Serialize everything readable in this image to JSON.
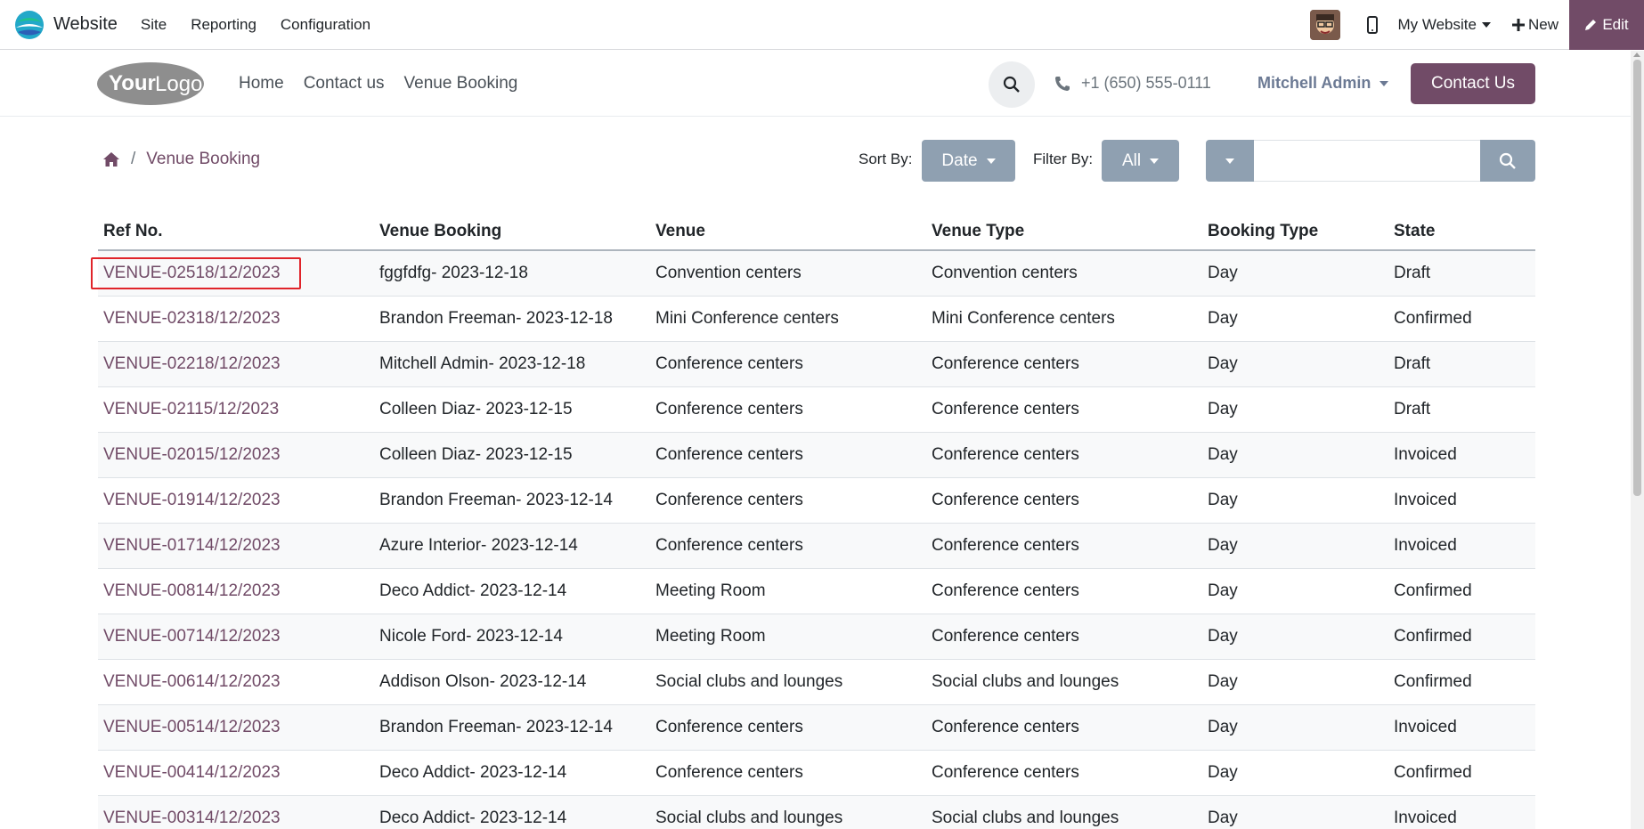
{
  "topbar": {
    "app_name": "Website",
    "menu": [
      "Site",
      "Reporting",
      "Configuration"
    ],
    "website_selector": "My Website",
    "new_label": "New",
    "edit_label": "Edit"
  },
  "header": {
    "logo_text": "YourLogo",
    "nav": [
      "Home",
      "Contact us",
      "Venue Booking"
    ],
    "phone": "+1 (650) 555-0111",
    "user": "Mitchell Admin",
    "contact_button": "Contact Us"
  },
  "controls": {
    "breadcrumb_current": "Venue Booking",
    "sort_label": "Sort By:",
    "sort_value": "Date",
    "filter_label": "Filter By:",
    "filter_value": "All",
    "search_value": ""
  },
  "table": {
    "columns": [
      "Ref No.",
      "Venue Booking",
      "Venue",
      "Venue Type",
      "Booking Type",
      "State"
    ],
    "rows": [
      [
        "VENUE-02518/12/2023",
        "fggfdfg- 2023-12-18",
        "Convention centers",
        "Convention centers",
        "Day",
        "Draft"
      ],
      [
        "VENUE-02318/12/2023",
        "Brandon Freeman- 2023-12-18",
        "Mini Conference centers",
        "Mini Conference centers",
        "Day",
        "Confirmed"
      ],
      [
        "VENUE-02218/12/2023",
        "Mitchell Admin- 2023-12-18",
        "Conference centers",
        "Conference centers",
        "Day",
        "Draft"
      ],
      [
        "VENUE-02115/12/2023",
        "Colleen Diaz- 2023-12-15",
        "Conference centers",
        "Conference centers",
        "Day",
        "Draft"
      ],
      [
        "VENUE-02015/12/2023",
        "Colleen Diaz- 2023-12-15",
        "Conference centers",
        "Conference centers",
        "Day",
        "Invoiced"
      ],
      [
        "VENUE-01914/12/2023",
        "Brandon Freeman- 2023-12-14",
        "Conference centers",
        "Conference centers",
        "Day",
        "Invoiced"
      ],
      [
        "VENUE-01714/12/2023",
        "Azure Interior- 2023-12-14",
        "Conference centers",
        "Conference centers",
        "Day",
        "Invoiced"
      ],
      [
        "VENUE-00814/12/2023",
        "Deco Addict- 2023-12-14",
        "Meeting Room",
        "Conference centers",
        "Day",
        "Confirmed"
      ],
      [
        "VENUE-00714/12/2023",
        "Nicole Ford- 2023-12-14",
        "Meeting Room",
        "Conference centers",
        "Day",
        "Confirmed"
      ],
      [
        "VENUE-00614/12/2023",
        "Addison Olson- 2023-12-14",
        "Social clubs and lounges",
        "Social clubs and lounges",
        "Day",
        "Confirmed"
      ],
      [
        "VENUE-00514/12/2023",
        "Brandon Freeman- 2023-12-14",
        "Conference centers",
        "Conference centers",
        "Day",
        "Invoiced"
      ],
      [
        "VENUE-00414/12/2023",
        "Deco Addict- 2023-12-14",
        "Conference centers",
        "Conference centers",
        "Day",
        "Confirmed"
      ],
      [
        "VENUE-00314/12/2023",
        "Deco Addict- 2023-12-14",
        "Social clubs and lounges",
        "Social clubs and lounges",
        "Day",
        "Invoiced"
      ]
    ]
  },
  "colors": {
    "brand": "#714b67",
    "button_gray": "#8fa0b1",
    "highlight": "#e0242a"
  },
  "icons": [
    "odoo-website-icon",
    "avatar-icon",
    "mobile-icon",
    "plus-icon",
    "pencil-icon",
    "search-icon",
    "phone-icon",
    "home-icon",
    "chevron-down-icon"
  ]
}
